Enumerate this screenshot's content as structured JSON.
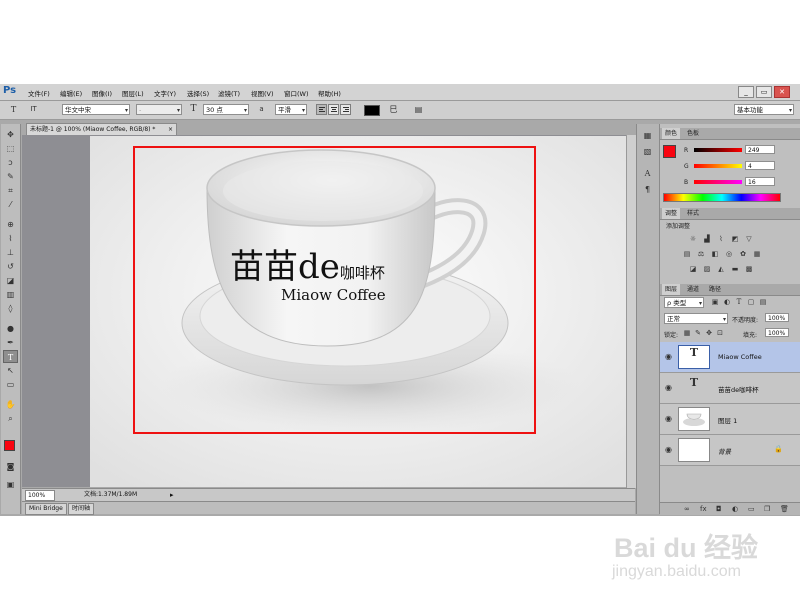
{
  "app": {
    "logo": "Ps"
  },
  "menu": [
    "文件(F)",
    "编辑(E)",
    "图像(I)",
    "图层(L)",
    "文字(Y)",
    "选择(S)",
    "滤镜(T)",
    "视图(V)",
    "窗口(W)",
    "帮助(H)"
  ],
  "window_controls": [
    "_",
    "▭",
    "✕"
  ],
  "options": {
    "tool_glyph": "T",
    "orient_glyph": "IT",
    "font_family": "华文中宋",
    "font_style": "-",
    "size_glyph": "T",
    "font_size": "30 点",
    "aa_glyph": "a",
    "antialias": "平滑",
    "color_swatch": "#000000",
    "workspace": "基本功能"
  },
  "document": {
    "tab_title": "未标题-1 @ 100% (Miaow Coffee, RGB/8) *",
    "tab_close": "×",
    "cup_title_main": "苗苗de",
    "cup_title_small": "咖啡杯",
    "cup_subtitle": "Miaow Coffee"
  },
  "status": {
    "zoom": "100%",
    "doc_info": "文档:1.37M/1.89M"
  },
  "bottom_tabs": [
    "Mini Bridge",
    "时间轴"
  ],
  "color_panel": {
    "tabs": [
      "颜色",
      "色板"
    ],
    "channels": [
      {
        "label": "R",
        "value": "249"
      },
      {
        "label": "G",
        "value": "4"
      },
      {
        "label": "B",
        "value": "16"
      }
    ],
    "foreground": "#f90410",
    "background": "#ffffff"
  },
  "adjust_panel": {
    "tabs": [
      "调整",
      "样式"
    ],
    "title": "添加调整"
  },
  "layers_panel": {
    "tabs": [
      "图层",
      "通道",
      "路径"
    ],
    "filter_label": "ρ 类型",
    "blend_mode": "正常",
    "opacity_label": "不透明度:",
    "opacity": "100%",
    "lock_label": "锁定:",
    "fill_label": "填充:",
    "fill": "100%",
    "layers": [
      {
        "name": "Miaow Coffee",
        "thumb": "T",
        "selected": true
      },
      {
        "name": "苗苗de咖啡杯",
        "thumb": "T",
        "selected": false
      },
      {
        "name": "图层 1",
        "thumb": "",
        "selected": false
      },
      {
        "name": "背景",
        "thumb": "",
        "selected": false,
        "locked": true
      }
    ],
    "footer_icons": [
      "∞",
      "fx",
      "◘",
      "◐",
      "▭",
      "❐",
      "🗑"
    ]
  },
  "watermark": {
    "line1": "Bai du 经验",
    "line2": "jingyan.baidu.com"
  }
}
